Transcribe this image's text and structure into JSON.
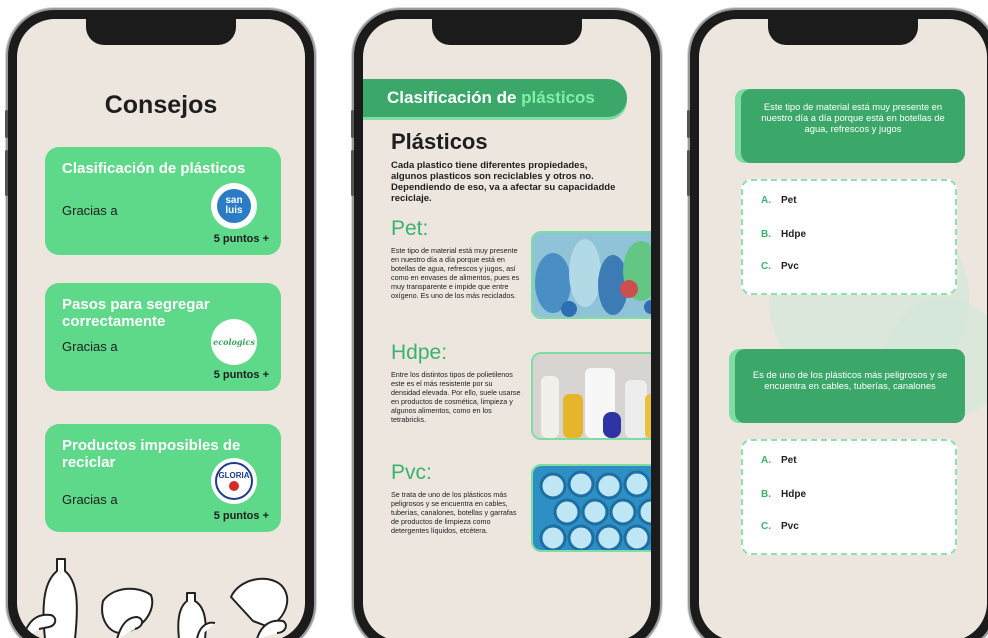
{
  "screen1": {
    "title": "Consejos",
    "cards": [
      {
        "title": "Clasificación de plásticos",
        "thanks": "Gracias a",
        "logo_text": "san\nluis",
        "points": "5 puntos +"
      },
      {
        "title": "Pasos para segregar correctamente",
        "thanks": "Gracias a",
        "logo_text": "ecologics",
        "points": "5 puntos +"
      },
      {
        "title": "Productos imposibles de reciclar",
        "thanks": "Gracias a",
        "logo_text": "GLORIA",
        "points": "5 puntos +"
      }
    ]
  },
  "screen2": {
    "banner_part1": "Clasificación de",
    "banner_part2": "plásticos",
    "heading": "Plásticos",
    "intro": "Cada plastico tiene diferentes propiedades, algunos plasticos son reciclables y otros no. Dependiendo de eso, va a afectar su capacidadde reciclaje.",
    "types": [
      {
        "name": "Pet:",
        "desc": "Este tipo de material está muy presente en nuestro día a día porque está en botellas de agua, refrescos y jugos, así como en envases de alimentos, pues es muy transparente e impide que entre oxígeno. Es uno de los más reciclados."
      },
      {
        "name": "Hdpe:",
        "desc": "Entre los distintos tipos de polietilenos este es el más resistente por su densidad elevada. Por ello, suele usarse en productos de cosmética, limpieza y algunos alimentos, como en los tetrabricks."
      },
      {
        "name": "Pvc:",
        "desc": "Se trata de uno de los plásticos más peligrosos y se encuentra en cables, tuberías, canalones, botellas y garrafas de productos de limpieza como detergentes líquidos, etcétera."
      }
    ]
  },
  "screen3": {
    "questions": [
      {
        "text": "Este tipo de material está muy presente en nuestro día a día porque está en botellas de agua, refrescos y jugos",
        "options": [
          {
            "letter": "A.",
            "label": "Pet"
          },
          {
            "letter": "B.",
            "label": "Hdpe"
          },
          {
            "letter": "C.",
            "label": "Pvc"
          }
        ]
      },
      {
        "text": "Es de uno de los plásticos más peligrosos y se encuentra en cables, tuberías, canalones",
        "options": [
          {
            "letter": "A.",
            "label": "Pet"
          },
          {
            "letter": "B.",
            "label": "Hdpe"
          },
          {
            "letter": "C.",
            "label": "Pvc"
          }
        ]
      }
    ]
  },
  "colors": {
    "card_green": "#5ed889",
    "dark_green": "#3ba86a",
    "accent_green": "#3bb36d",
    "screen_bg": "#ece6df"
  }
}
